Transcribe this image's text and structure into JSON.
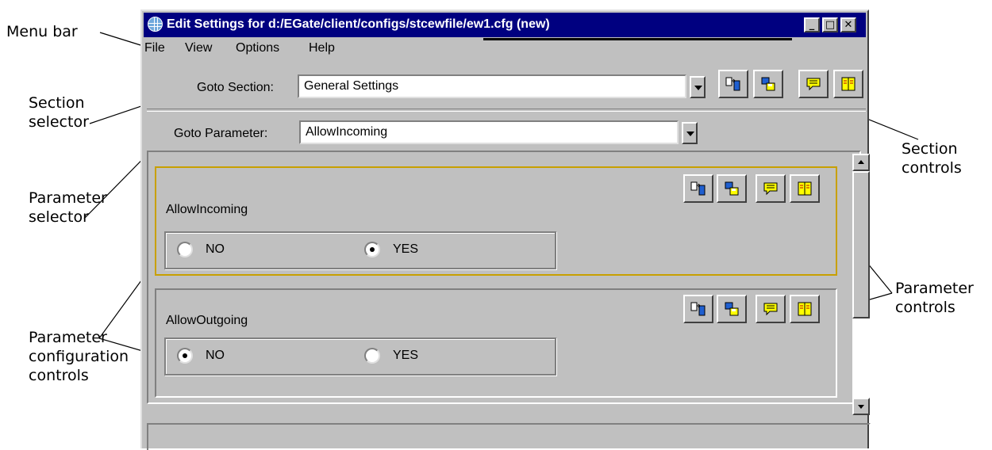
{
  "callouts": {
    "menu_bar": "Menu bar",
    "section_selector": [
      "Section",
      "selector"
    ],
    "parameter_selector": [
      "Parameter",
      "selector"
    ],
    "parameter_config": [
      "Parameter",
      "configuration",
      "controls"
    ],
    "section_controls": [
      "Section",
      "controls"
    ],
    "parameter_controls": [
      "Parameter",
      "controls"
    ]
  },
  "window": {
    "title": "Edit Settings for d:/EGate/client/configs/stcewfile/ew1.cfg (new)",
    "buttons": {
      "minimize": "_",
      "maximize": "□",
      "close": "✕"
    }
  },
  "menu": [
    "File",
    "View",
    "Options",
    "Help"
  ],
  "section": {
    "label": "Goto Section:",
    "value": "General Settings",
    "controls": [
      "import-icon",
      "copy-save-icon",
      "comment-icon",
      "help-book-icon"
    ]
  },
  "parameter": {
    "label": "Goto Parameter:",
    "value": "AllowIncoming"
  },
  "params": [
    {
      "name": "AllowIncoming",
      "focused": true,
      "options": [
        {
          "label": "NO",
          "checked": false
        },
        {
          "label": "YES",
          "checked": true
        }
      ]
    },
    {
      "name": "AllowOutgoing",
      "focused": false,
      "options": [
        {
          "label": "NO",
          "checked": true
        },
        {
          "label": "YES",
          "checked": false
        }
      ]
    }
  ],
  "colors": {
    "titlebar": "#000080",
    "window_face": "#c0c0c0",
    "focus_border": "#c8a000",
    "icon_yellow": "#ffff00",
    "icon_blue": "#1f5fd0"
  }
}
